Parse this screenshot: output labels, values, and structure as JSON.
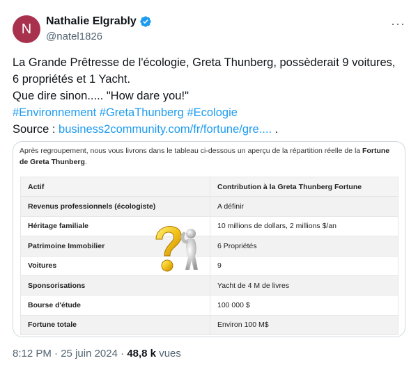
{
  "author": {
    "avatar_letter": "N",
    "display_name": "Nathalie Elgrably",
    "handle": "@natel1826",
    "verified": true,
    "avatar_color": "#a8324d",
    "verified_color": "#1d9bf0"
  },
  "tweet": {
    "line1": "La Grande Prêtresse de l'écologie, Greta Thunberg, possèderait 9 voitures,",
    "line2": "6 propriétés et 1 Yacht.",
    "line3": "Que dire sinon.....  \"How dare you!\"",
    "hashtags": [
      "#Environnement",
      "#GretaThunberg",
      "#Ecologie"
    ],
    "source_label": "Source : ",
    "source_link": "business2community.com/fr/fortune/gre....",
    "source_suffix": " ."
  },
  "card": {
    "intro": "Après regroupement, nous vous livrons dans le tableau ci-dessous un aperçu de la répartition réelle de la ",
    "intro_bold": "Fortune de Greta Thunberg",
    "intro_end": ".",
    "table": {
      "headers": [
        "Actif",
        "Contribution à la  Greta Thunberg Fortune"
      ],
      "rows": [
        [
          "Revenus professionnels (écologiste)",
          "A définir"
        ],
        [
          "Héritage familiale",
          "10 millions de dollars, 2 millions $/an"
        ],
        [
          "Patrimoine Immobilier",
          "6 Propriétés"
        ],
        [
          "Voitures",
          "9"
        ],
        [
          "Sponsorisations",
          "Yacht de 4 M de livres"
        ],
        [
          "Bourse d'étude",
          "100 000 $"
        ],
        [
          "Fortune totale",
          "Environ 100 M$"
        ]
      ]
    },
    "image_icon": "question-mark-figure-icon"
  },
  "meta": {
    "time": "8:12 PM",
    "separator": " · ",
    "date": "25 juin 2024",
    "views_count": "48,8 k",
    "views_label": " vues"
  },
  "menu_icon": "more-options-icon"
}
